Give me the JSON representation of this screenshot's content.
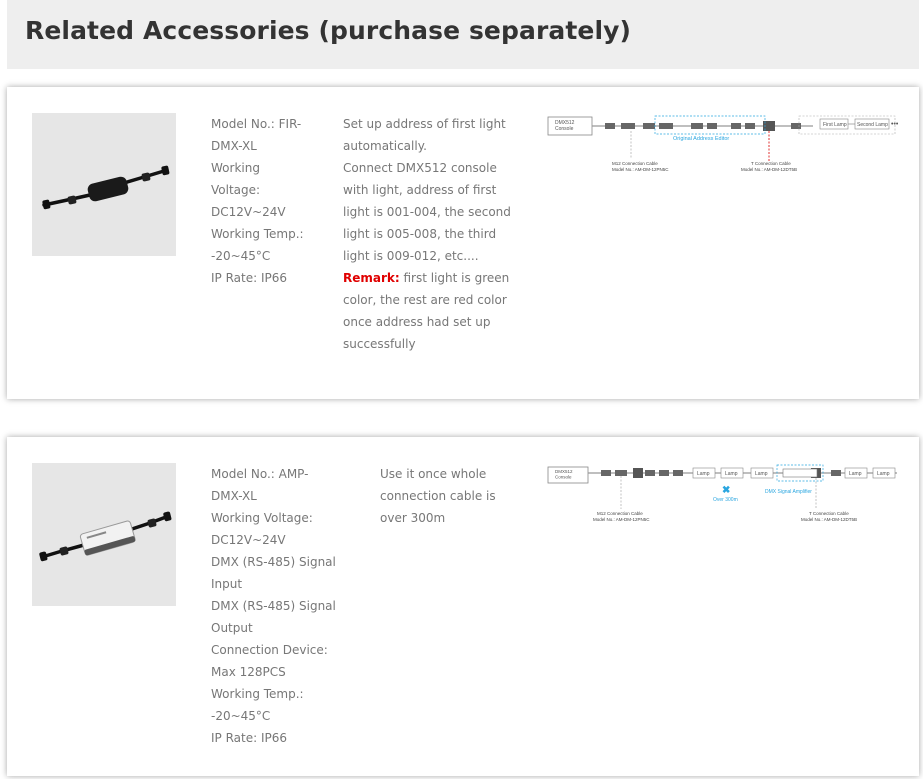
{
  "header": {
    "title": "Related Accessories (purchase separately)"
  },
  "products": [
    {
      "spec_lines": [
        "Model No.: FIR-",
        "DMX-XL",
        "Working",
        "Voltage:",
        "DC12V~24V",
        "Working Temp.:",
        "-20~45°C",
        "IP Rate: IP66"
      ],
      "desc_lines": [
        "Set up address of first light",
        "automatically.",
        "Connect DMX512 console",
        "with light, address of first",
        "light is 001-004, the second",
        "light is 005-008, the third",
        "light is 009-012, etc...."
      ],
      "remark_label": "Remark:",
      "remark_lines": [
        " first light is green",
        "color, the rest are red color",
        "once address had set up",
        "successfully"
      ],
      "diagram": {
        "console": "DMX512\nConsole",
        "editor_label": "Original Address Editor",
        "cable1_label": "M12 Connection Cable",
        "cable1_model": "Model No.: AM-DM-12PN5C",
        "cable2_label": "T Connection Cable",
        "cable2_model": "Model No.: AM-DM-12DT5B",
        "first_lamp": "First Lamp",
        "second_lamp": "Second Lamp"
      }
    },
    {
      "spec_lines": [
        "Model No.: AMP-",
        "DMX-XL",
        "Working Voltage:",
        "DC12V~24V",
        "DMX (RS-485) Signal",
        "Input",
        "DMX (RS-485) Signal",
        "Output",
        "Connection Device:",
        "Max 128PCS",
        "Working Temp.:",
        "-20~45°C",
        "IP Rate: IP66"
      ],
      "desc_lines": [
        "Use it once whole",
        "connection cable is",
        "over 300m"
      ],
      "diagram": {
        "console": "DMX512\nConsole",
        "lamp": "Lamp",
        "over_label": "Over 300m",
        "amp_label": "DMX Signal Amplifier",
        "cable1_label": "M12 Connection Cable",
        "cable1_model": "Model No.: AM-DM-12PN5C",
        "cable2_label": "T Connection Cable",
        "cable2_model": "Model No.: AM-DM-12DT5B"
      }
    }
  ],
  "colors": {
    "remark": "#e00000",
    "diagram_accent": "#2aa6e0",
    "diagram_red": "#e03030"
  }
}
